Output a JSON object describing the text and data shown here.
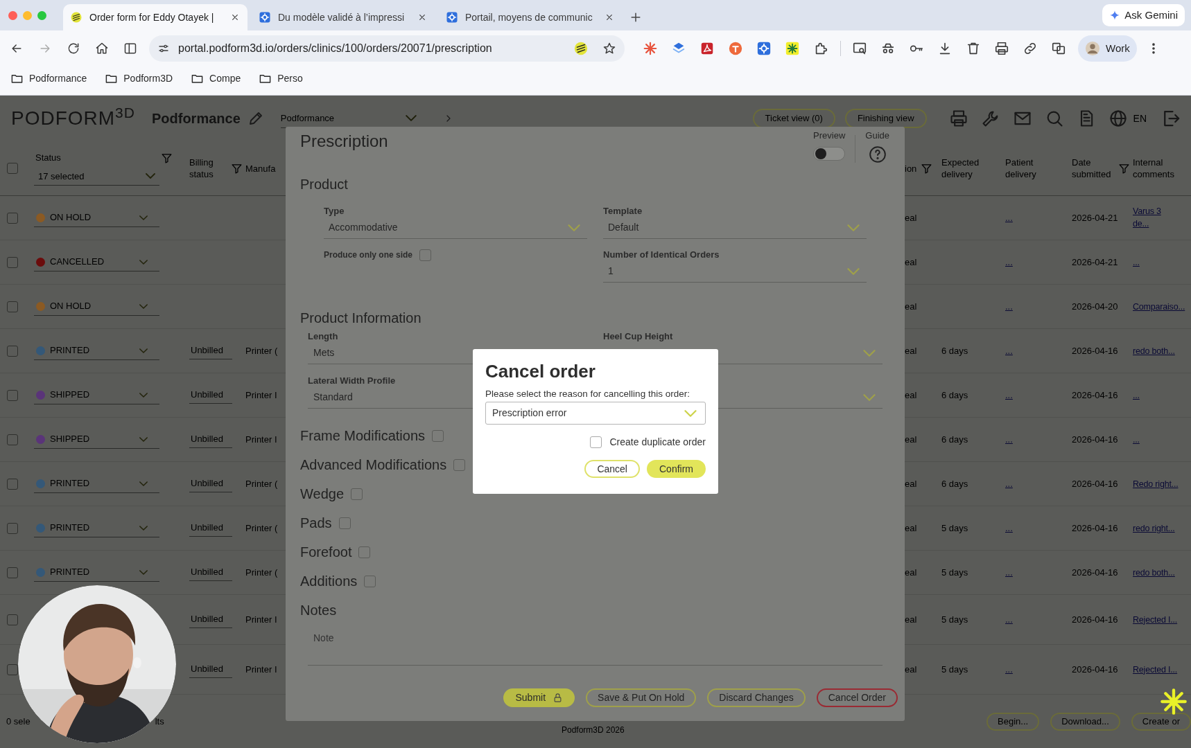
{
  "browser": {
    "tabs": [
      {
        "title": "Order form for Eddy Otayek |",
        "selected": true
      },
      {
        "title": "Du modèle validé à l’impressi",
        "selected": false
      },
      {
        "title": "Portail, moyens de communic",
        "selected": false
      }
    ],
    "ask_gemini": "Ask Gemini",
    "url": "portal.podform3d.io/orders/clinics/100/orders/20071/prescription",
    "profile": "Work",
    "bookmarks": [
      "Podformance",
      "Podform3D",
      "Compe",
      "Perso"
    ]
  },
  "app_header": {
    "logo": "PODFORM$^{3D}$",
    "clinic": "Podformance",
    "clinic_select": "Podformance",
    "buttons": [
      "Ticket view (0)",
      "Finishing view"
    ],
    "language": "EN"
  },
  "table": {
    "select_all": {
      "checked": false
    },
    "status_column": {
      "label": "Status",
      "value": "17 selected",
      "filter": true
    },
    "columns": [
      {
        "label": "Billing status",
        "filter": true
      },
      {
        "label": "Manufa",
        "filter": false
      },
      {
        "label": "ion",
        "filter": true
      },
      {
        "label": "Expected delivery",
        "filter": false
      },
      {
        "label": "Patient delivery",
        "filter": false
      },
      {
        "label": "Date submitted",
        "filter": true
      },
      {
        "label": "Internal comments",
        "filter": false
      }
    ],
    "rows": [
      {
        "checked": false,
        "status": "ON HOLD",
        "color": "#8b5a23",
        "col_3": "eal",
        "patient": "...",
        "date": "2026-04-21",
        "comment": "Varus 3 de..."
      },
      {
        "checked": false,
        "status": "CANCELLED",
        "color": "#6b0c0c",
        "col_3": "eal",
        "patient": "...",
        "date": "2026-04-21",
        "comment": "..."
      },
      {
        "checked": false,
        "status": "ON HOLD",
        "color": "#8b5a23",
        "col_3": "eal",
        "patient": "...",
        "date": "2026-04-20",
        "comment": "Comparaiso..."
      },
      {
        "checked": false,
        "status": "PRINTED",
        "color": "#345878",
        "billing": "Unbilled",
        "manufacturer": "Printer (",
        "col_3": "eal",
        "expected": "6 days",
        "patient": "...",
        "date": "2026-04-16",
        "comment": "redo both..."
      },
      {
        "checked": false,
        "status": "SHIPPED",
        "color": "#5a3479",
        "billing": "Unbilled",
        "manufacturer": "Printer I",
        "col_3": "eal",
        "expected": "6 days",
        "patient": "...",
        "date": "2026-04-16",
        "comment": "..."
      },
      {
        "checked": false,
        "status": "SHIPPED",
        "color": "#5a3479",
        "billing": "Unbilled",
        "manufacturer": "Printer I",
        "col_3": "eal",
        "expected": "6 days",
        "patient": "...",
        "date": "2026-04-16",
        "comment": "..."
      },
      {
        "checked": false,
        "status": "PRINTED",
        "color": "#345878",
        "billing": "Unbilled",
        "manufacturer": "Printer (",
        "col_3": "eal",
        "expected": "6 days",
        "patient": "...",
        "date": "2026-04-16",
        "comment": "Redo right..."
      },
      {
        "checked": false,
        "status": "PRINTED",
        "color": "#345878",
        "billing": "Unbilled",
        "manufacturer": "Printer (",
        "col_3": "eal",
        "expected": "5 days",
        "patient": "...",
        "date": "2026-04-16",
        "comment": "redo right..."
      },
      {
        "checked": false,
        "status": "PRINTED",
        "color": "#345878",
        "billing": "Unbilled",
        "manufacturer": "Printer (",
        "col_3": "eal",
        "expected": "5 days",
        "patient": "...",
        "date": "2026-04-16",
        "comment": "redo both..."
      },
      {
        "checked": false,
        "billing": "Unbilled",
        "manufacturer": "Printer I",
        "col_3": "eal",
        "expected": "5 days",
        "patient": "...",
        "date": "2026-04-16",
        "comment": "Rejected I..."
      },
      {
        "checked": false,
        "billing": "Unbilled",
        "manufacturer": "Printer I",
        "col_3": "eal",
        "expected": "5 days",
        "patient": "...",
        "date": "2026-04-16",
        "comment": "Rejected I..."
      }
    ]
  },
  "footer": {
    "selection": "0 sele",
    "results": "lts",
    "buttons": [
      "Begin...",
      "Download...",
      "Create or"
    ],
    "copyright": "Podform3D 2026"
  },
  "prescription": {
    "title": "Prescription",
    "preview": {
      "label": "Preview",
      "on": false
    },
    "guide": "Guide",
    "product": {
      "heading": "Product",
      "type": {
        "label": "Type",
        "value": "Accommodative"
      },
      "template": {
        "label": "Template",
        "value": "Default"
      },
      "one_side": {
        "label": "Produce only one side",
        "checked": false
      },
      "identical_orders": {
        "label": "Number of Identical Orders",
        "value": "1"
      }
    },
    "product_information": {
      "heading": "Product Information",
      "length": {
        "label": "Length",
        "value": "Mets"
      },
      "heel_cup_height": {
        "label": "Heel Cup Height"
      },
      "lateral_width_profile": {
        "label": "Lateral Width Profile",
        "value": "Standard"
      }
    },
    "options": [
      {
        "label": "Frame Modifications",
        "checked": false
      },
      {
        "label": "Advanced Modifications",
        "checked": false
      },
      {
        "label": "Wedge",
        "checked": false
      },
      {
        "label": "Pads",
        "checked": false
      },
      {
        "label": "Forefoot",
        "checked": false
      },
      {
        "label": "Additions",
        "checked": false
      }
    ],
    "notes": {
      "heading": "Notes",
      "placeholder": "Note"
    },
    "actions": [
      {
        "label": "Submit",
        "kind": "primary"
      },
      {
        "label": "Save & Put On Hold",
        "kind": "outline"
      },
      {
        "label": "Discard Changes",
        "kind": "outline"
      },
      {
        "label": "Cancel Order",
        "kind": "danger"
      }
    ]
  },
  "dialog": {
    "title": "Cancel order",
    "prompt": "Please select the reason for cancelling this order:",
    "reason": "Prescription error",
    "duplicate": {
      "label": "Create duplicate order",
      "checked": false
    },
    "buttons": [
      {
        "label": "Cancel",
        "kind": "outline"
      },
      {
        "label": "Confirm",
        "kind": "primary"
      }
    ]
  }
}
